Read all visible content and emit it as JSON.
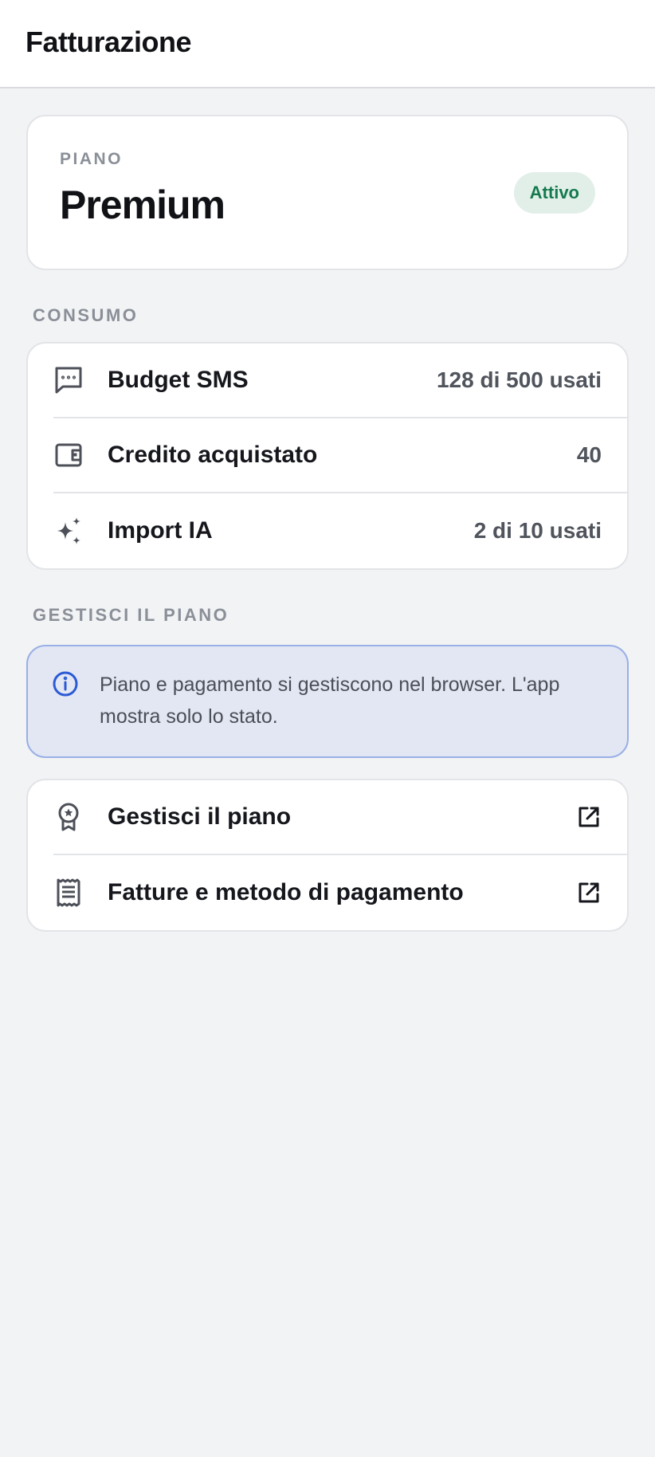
{
  "header": {
    "title": "Fatturazione"
  },
  "plan": {
    "eyebrow": "PIANO",
    "name": "Premium",
    "status": "Attivo"
  },
  "usage": {
    "section_label": "CONSUMO",
    "items": [
      {
        "icon": "message-icon",
        "label": "Budget SMS",
        "value": "128 di 500 usati"
      },
      {
        "icon": "wallet-icon",
        "label": "Credito acquistato",
        "value": "40"
      },
      {
        "icon": "sparkles-icon",
        "label": "Import IA",
        "value": "2 di 10 usati"
      }
    ]
  },
  "manage": {
    "section_label": "GESTISCI IL PIANO",
    "info_text": "Piano e pagamento si gestiscono nel browser. L'app mostra solo lo stato.",
    "items": [
      {
        "icon": "award-icon",
        "label": "Gestisci il piano",
        "action_icon": "external-link-icon"
      },
      {
        "icon": "receipt-icon",
        "label": "Fatture e metodo di pagamento",
        "action_icon": "external-link-icon"
      }
    ]
  },
  "colors": {
    "accent_info": "#2c5ad6",
    "status_green": "#147a4e",
    "icon_gray": "#4d5058"
  }
}
